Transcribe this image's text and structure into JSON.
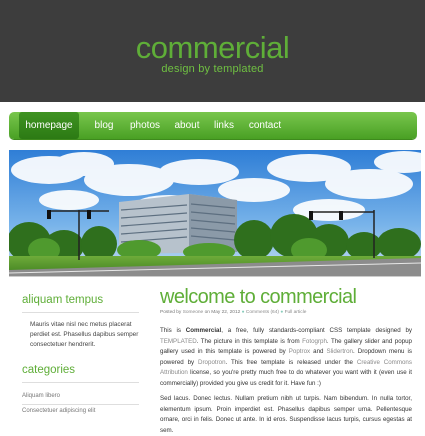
{
  "header": {
    "logo": "commercial",
    "tagline": "design by templated"
  },
  "nav": {
    "items": [
      "homepage",
      "blog",
      "photos",
      "about",
      "links",
      "contact"
    ],
    "active_index": 0
  },
  "sidebar": {
    "section1_title": "aliquam tempus",
    "section1_text": "Mauris vitae nisl nec metus placerat perdiet est. Phasellus dapibus semper consectetuer hendrerit.",
    "section2_title": "categories",
    "categories": [
      "Aliquam libero",
      "Consectetuer adipiscing elit"
    ]
  },
  "main": {
    "title": "welcome to commercial",
    "meta": {
      "posted": "Posted by",
      "author": "Someone",
      "on": "on May 22, 2012",
      "comments": "Comments (64)",
      "full": "Full article"
    },
    "p1": {
      "a": "This is",
      "b": "Commercial",
      "c": ", a free, fully standards-compliant CSS template designed by",
      "d": "TEMPLATED",
      "e": ". The picture in this template is from",
      "f": "Fotogrph",
      "g": ". The gallery slider and popup gallery used in this template is powered by",
      "h": "Poptrox",
      "i": "and",
      "j": "Slidertron",
      "k": ". Dropdown menu is powered by",
      "l": "Dropotron",
      "m": ". This free template is released under the",
      "n": "Creative Commons Attribution",
      "o": "license, so you're pretty much free to do whatever you want with it (even use it commercially) provided you give us credit for it. Have fun :)"
    },
    "p2": "Sed lacus. Donec lectus. Nullam pretium nibh ut turpis. Nam bibendum. In nulla tortor, elementum ipsum. Proin imperdiet est. Phasellus dapibus semper urna. Pellentesque ornare, orci in felis. Donec ut ante. In id eros. Suspendisse lacus turpis, cursus egestas at sem."
  },
  "colors": {
    "header_bg": "#3d3d3d",
    "accent_green": "#5fae38",
    "nav_gradient_top": "#79c64d",
    "nav_gradient_bottom": "#49a024"
  }
}
